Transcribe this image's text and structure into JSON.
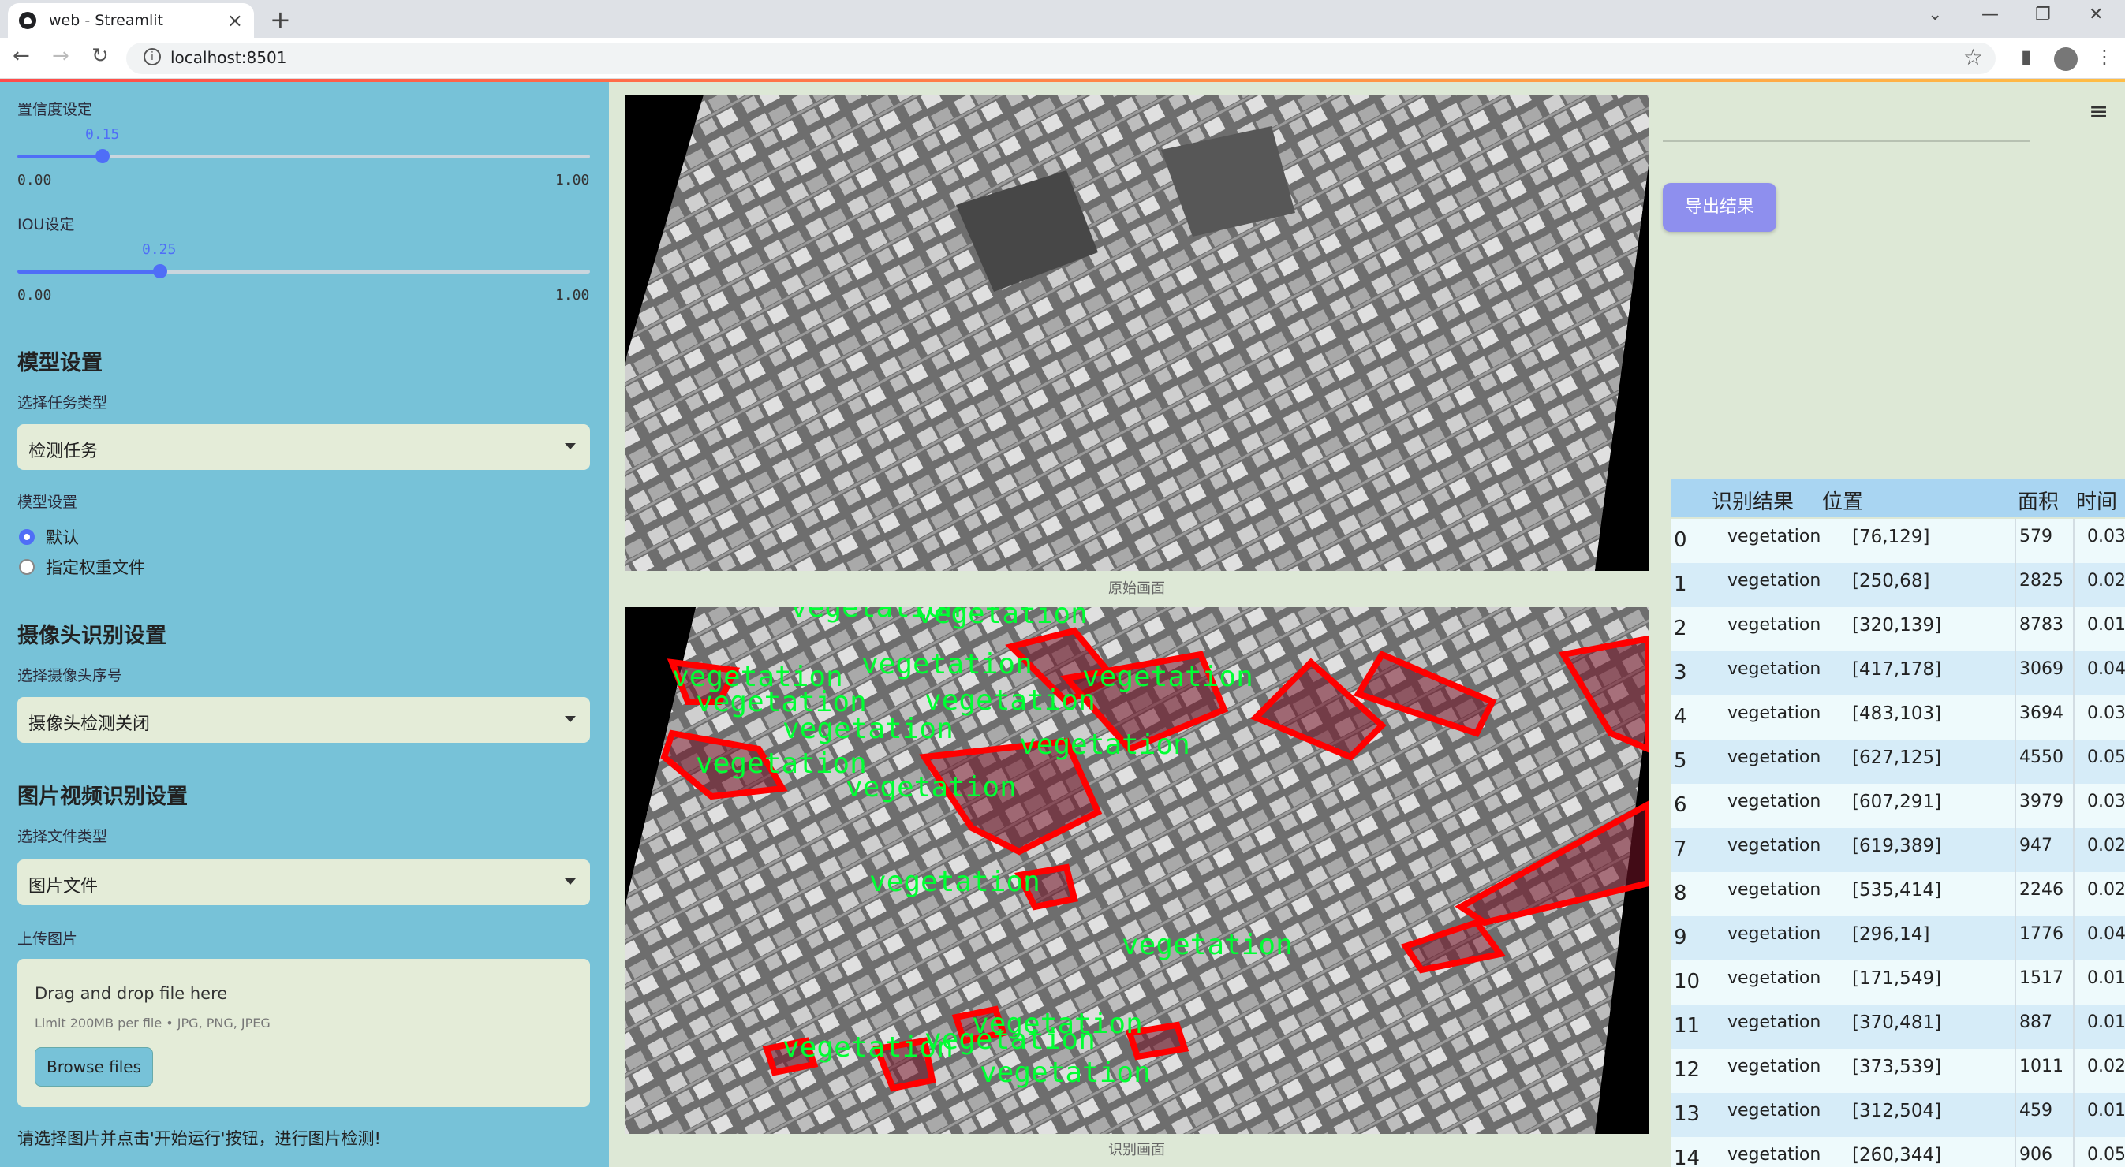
{
  "browser": {
    "tab_title": "web - Streamlit",
    "url": "localhost:8501"
  },
  "sidebar": {
    "confidence": {
      "label": "置信度设定",
      "value": "0.15",
      "min": "0.00",
      "max": "1.00",
      "fraction": 0.15
    },
    "iou": {
      "label": "IOU设定",
      "value": "0.25",
      "min": "0.00",
      "max": "1.00",
      "fraction": 0.25
    },
    "model_section": "模型设置",
    "task_label": "选择任务类型",
    "task_value": "检测任务",
    "model_label": "模型设置",
    "radio_default": "默认",
    "radio_custom": "指定权重文件",
    "camera_section": "摄像头识别设置",
    "camera_label": "选择摄像头序号",
    "camera_value": "摄像头检测关闭",
    "media_section": "图片视频识别设置",
    "file_type_label": "选择文件类型",
    "file_type_value": "图片文件",
    "upload_label": "上传图片",
    "drop_text": "Drag and drop file here",
    "limit_text": "Limit 200MB per file • JPG, PNG, JPEG",
    "browse_label": "Browse files",
    "hint": "请选择图片并点击'开始运行'按钮，进行图片检测!"
  },
  "main": {
    "original_caption": "原始画面",
    "result_caption": "识别画面",
    "export_label": "导出结果",
    "detection_label": "vegetation"
  },
  "table": {
    "headers": {
      "result": "识别结果",
      "position": "位置",
      "area": "面积",
      "time": "时间"
    },
    "rows": [
      {
        "i": "0",
        "c": "vegetation",
        "p": "[76,129]",
        "a": "579",
        "t": "0.03"
      },
      {
        "i": "1",
        "c": "vegetation",
        "p": "[250,68]",
        "a": "2825",
        "t": "0.02"
      },
      {
        "i": "2",
        "c": "vegetation",
        "p": "[320,139]",
        "a": "8783",
        "t": "0.01"
      },
      {
        "i": "3",
        "c": "vegetation",
        "p": "[417,178]",
        "a": "3069",
        "t": "0.04"
      },
      {
        "i": "4",
        "c": "vegetation",
        "p": "[483,103]",
        "a": "3694",
        "t": "0.03"
      },
      {
        "i": "5",
        "c": "vegetation",
        "p": "[627,125]",
        "a": "4550",
        "t": "0.05"
      },
      {
        "i": "6",
        "c": "vegetation",
        "p": "[607,291]",
        "a": "3979",
        "t": "0.03"
      },
      {
        "i": "7",
        "c": "vegetation",
        "p": "[619,389]",
        "a": "947",
        "t": "0.02"
      },
      {
        "i": "8",
        "c": "vegetation",
        "p": "[535,414]",
        "a": "2246",
        "t": "0.02"
      },
      {
        "i": "9",
        "c": "vegetation",
        "p": "[296,14]",
        "a": "1776",
        "t": "0.04"
      },
      {
        "i": "10",
        "c": "vegetation",
        "p": "[171,549]",
        "a": "1517",
        "t": "0.01"
      },
      {
        "i": "11",
        "c": "vegetation",
        "p": "[370,481]",
        "a": "887",
        "t": "0.01"
      },
      {
        "i": "12",
        "c": "vegetation",
        "p": "[373,539]",
        "a": "1011",
        "t": "0.02"
      },
      {
        "i": "13",
        "c": "vegetation",
        "p": "[312,504]",
        "a": "459",
        "t": "0.01"
      },
      {
        "i": "14",
        "c": "vegetation",
        "p": "[260,344]",
        "a": "906",
        "t": "0.05"
      }
    ]
  }
}
